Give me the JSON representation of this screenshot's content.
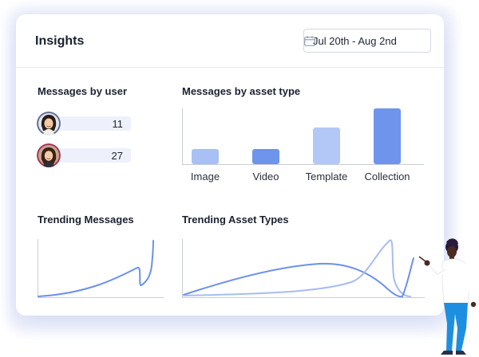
{
  "header": {
    "title": "Insights",
    "date_range": "Jul 20th - Aug 2nd"
  },
  "messages_by_user": {
    "title": "Messages by user",
    "users": [
      {
        "count": "11",
        "skin": "#f2c9a4",
        "hair": "#2b1d16",
        "ring": "#5f6f8f"
      },
      {
        "count": "27",
        "skin": "#f3cba7",
        "hair": "#3a2217",
        "ring": "#a13555"
      }
    ]
  },
  "messages_by_asset_type": {
    "title": "Messages by asset type",
    "chart_data": {
      "type": "bar",
      "categories": [
        "Image",
        "Video",
        "Template",
        "Collection"
      ],
      "values": [
        19,
        19,
        46,
        70
      ],
      "ylim": [
        0,
        70
      ],
      "colors": [
        "#a9c0f4",
        "#6e94ec",
        "#b3c8f6",
        "#6e94ec"
      ]
    }
  },
  "trending_messages": {
    "title": "Trending Messages"
  },
  "trending_asset_types": {
    "title": "Trending Asset Types"
  },
  "colors": {
    "accent": "#6b91ea",
    "accent_light": "#a7bdf0"
  }
}
